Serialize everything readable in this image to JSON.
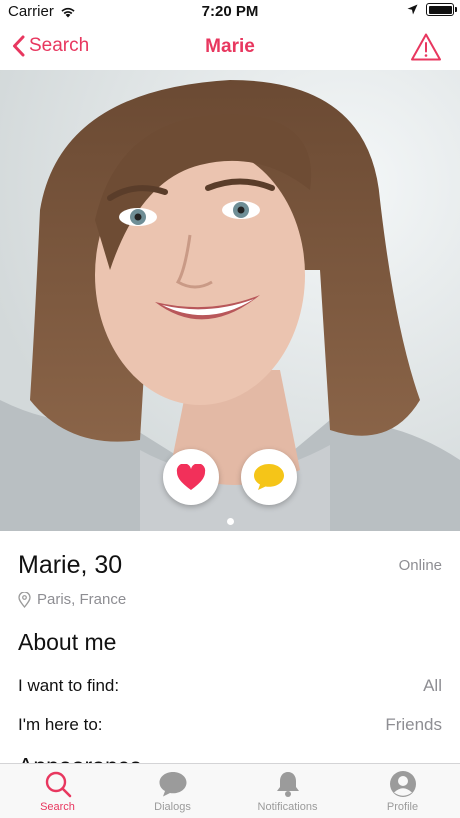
{
  "status_bar": {
    "carrier": "Carrier",
    "time": "7:20 PM"
  },
  "nav": {
    "back_label": "Search",
    "title": "Marie"
  },
  "photo": {
    "page_count": 1,
    "current_page": 1
  },
  "profile": {
    "name_age": "Marie, 30",
    "online_status": "Online",
    "location": "Paris, France",
    "about_title": "About me",
    "details": [
      {
        "label": "I want to find:",
        "value": "All"
      },
      {
        "label": "I'm here to:",
        "value": "Friends"
      }
    ],
    "next_section_title": "Appearance"
  },
  "tabs": [
    {
      "label": "Search",
      "icon": "search-icon",
      "active": true
    },
    {
      "label": "Dialogs",
      "icon": "chat-bubble-icon",
      "active": false
    },
    {
      "label": "Notifications",
      "icon": "bell-icon",
      "active": false
    },
    {
      "label": "Profile",
      "icon": "profile-icon",
      "active": false
    }
  ],
  "colors": {
    "accent": "#e8375f",
    "inactive": "#9b9b9b",
    "chat": "#f5c518",
    "like": "#f2305a"
  }
}
